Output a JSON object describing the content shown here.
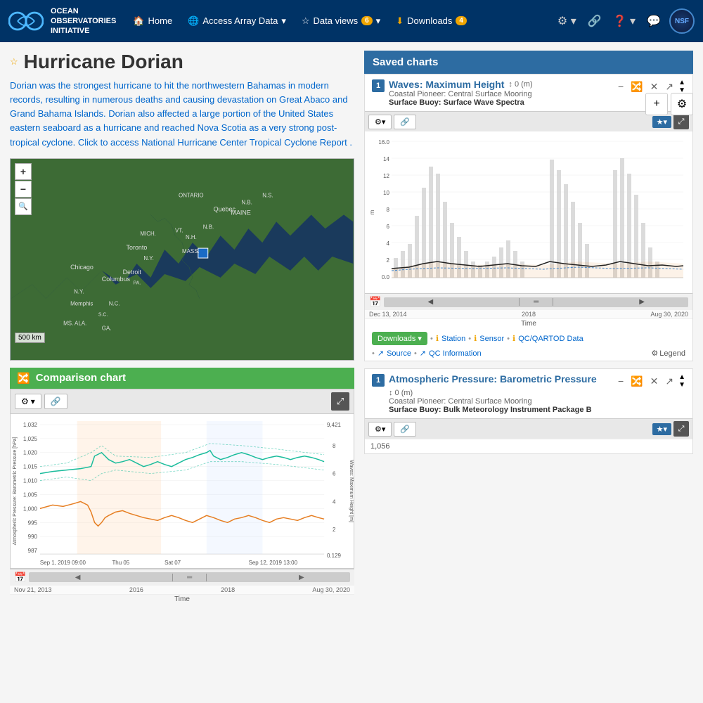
{
  "navbar": {
    "logo_text_line1": "OCEAN",
    "logo_text_line2": "OBSERVATORIES",
    "logo_text_line3": "INITIATIVE",
    "nav_home": "Home",
    "nav_access": "Access Array Data",
    "nav_dataviews": "Data views",
    "nav_dataviews_count": "6",
    "nav_downloads": "Downloads",
    "nav_downloads_count": "4",
    "nsf_label": "NSF"
  },
  "page": {
    "title": "Hurricane Dorian",
    "star_label": "★",
    "description": "Dorian was the strongest hurricane to hit the northwestern Bahamas in modern records, resulting in numerous deaths and causing devastation on Great Abaco and Grand Bahama Islands. Dorian also affected a large portion of the United States eastern seaboard as a hurricane and reached Nova Scotia as a very strong post-tropical cyclone. Click to access National Hurricane Center Tropical Cyclone Report .",
    "add_btn": "+",
    "settings_btn": "⚙"
  },
  "map": {
    "zoom_in": "+",
    "zoom_out": "−",
    "scale_label": "500 km"
  },
  "comparison_chart": {
    "title": "Comparison chart",
    "settings_label": "⚙",
    "expand_label": "⤢",
    "y_left_label": "Atmospheric Pressure: Barometric Pressure [hPa]",
    "y_right_label": "Waves: Maximum Height [m]",
    "x_start": "Sep 1, 2019 09:00",
    "x_mid1": "Thu 05",
    "x_mid2": "Sat 07",
    "x_end": "Sep 12, 2019 13:00",
    "time_label": "Time",
    "slider_left": "Nov 21, 2013",
    "slider_mid": "2016",
    "slider_mid2": "2018",
    "slider_right": "Aug 30, 2020",
    "y_values": [
      "1,032",
      "1,025",
      "1,020",
      "1,015",
      "1,010",
      "1,005",
      "1,000",
      "995",
      "990",
      "987"
    ],
    "y_right_values": [
      "9,421",
      "8",
      "6",
      "4",
      "2",
      "0.129"
    ]
  },
  "saved_charts": {
    "title": "Saved charts",
    "chart1": {
      "num": "1",
      "title": "Waves: Maximum Height",
      "offset": "↕ 0 (m)",
      "source_line1": "Coastal Pioneer: Central Surface Mooring",
      "source_line2": "Surface Buoy: Surface Wave Spectra",
      "y_max": "16.0",
      "y_vals": [
        "16.0",
        "14",
        "12",
        "10",
        "8",
        "6",
        "4",
        "2",
        "0.0"
      ],
      "unit": "m",
      "x_start": "Dec 13, 2014",
      "x_mid": "2018",
      "x_end": "Aug 30, 2020",
      "time_label": "Time",
      "dl_btn": "Downloads",
      "link_station": "Station",
      "link_sensor": "Sensor",
      "link_qc": "QC/QARTOD Data",
      "link_source": "Source",
      "link_qcinfo": "QC Information",
      "legend_label": "Legend"
    },
    "chart2": {
      "num": "1",
      "title": "Atmospheric Pressure: Barometric",
      "title2": "Pressure",
      "offset": "↕ 0 (m)",
      "source_line1": "Coastal Pioneer: Central Surface Mooring",
      "source_line2": "Surface Buoy: Bulk Meteorology Instrument Package B",
      "y_val": "1,056"
    }
  }
}
